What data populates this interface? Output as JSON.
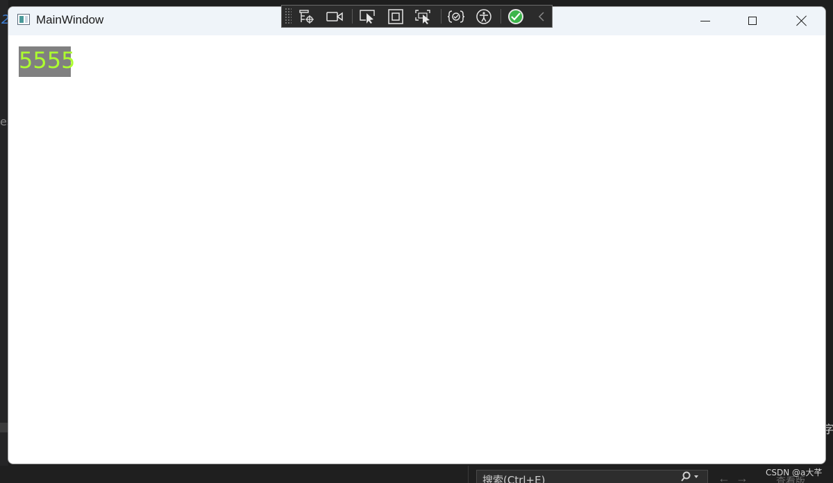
{
  "window": {
    "title": "MainWindow",
    "content_text": "5555",
    "colors": {
      "label_background": "#808080",
      "label_foreground": "#adff2f",
      "titlebar": "#eff4f9"
    }
  },
  "caption_buttons": {
    "minimize_icon": "minimize-icon",
    "maximize_icon": "maximize-icon",
    "close_icon": "close-icon"
  },
  "debug_toolbar": {
    "buttons": [
      "live-visual-tree-icon",
      "video-camera-icon",
      "select-element-icon",
      "display-layout-adorners-icon",
      "track-focus-icon",
      "binding-failures-icon",
      "accessibility-icon",
      "checkmark-icon",
      "collapse-chevron-icon"
    ]
  },
  "background_ide": {
    "search_placeholder": "搜索(Ctrl+E)",
    "view_label": "查看版",
    "right_edge_char": "字",
    "left_edge_text": "es"
  },
  "watermark": "CSDN @a大芊"
}
